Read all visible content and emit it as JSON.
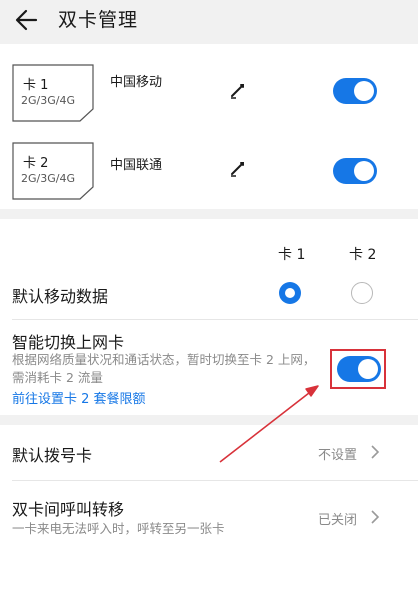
{
  "header": {
    "title": "双卡管理",
    "back_icon": "back-arrow-icon"
  },
  "sims": [
    {
      "sim_label": "卡 1",
      "network": "2G/3G/4G",
      "carrier": "中国移动",
      "enabled": true
    },
    {
      "sim_label": "卡 2",
      "network": "2G/3G/4G",
      "carrier": "中国联通",
      "enabled": true
    }
  ],
  "data_settings": {
    "col_sim1": "卡 1",
    "col_sim2": "卡 2",
    "default_mobile_data": {
      "label": "默认移动数据",
      "selected": "卡 1"
    },
    "smart_switch": {
      "label": "智能切换上网卡",
      "description": "根据网络质量状况和通话状态，暂时切换至卡 2 上网，需消耗卡 2 流量",
      "link": "前往设置卡 2 套餐限额",
      "enabled": true
    }
  },
  "call_settings": {
    "default_dial": {
      "label": "默认拨号卡",
      "value": "不设置"
    },
    "call_forward": {
      "label": "双卡间呼叫转移",
      "description": "一卡来电无法呼入时，呼转至另一张卡",
      "value": "已关闭"
    }
  },
  "colors": {
    "accent": "#1677e6",
    "annotation": "#d8323a"
  }
}
